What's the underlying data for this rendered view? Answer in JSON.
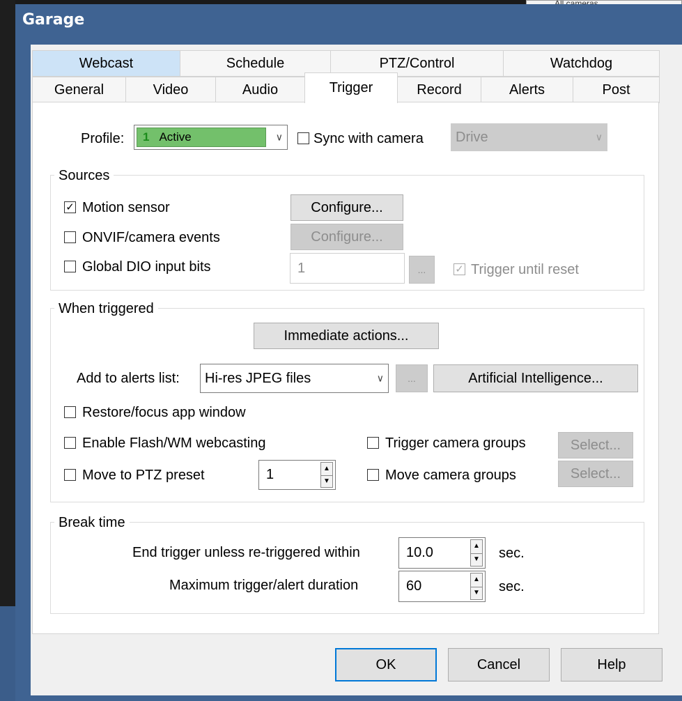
{
  "window": {
    "title": "Garage"
  },
  "background": {
    "camera_combo": "All cameras"
  },
  "tabs": {
    "row1": [
      "Webcast",
      "Schedule",
      "PTZ/Control",
      "Watchdog"
    ],
    "row2": [
      "General",
      "Video",
      "Audio",
      "Trigger",
      "Record",
      "Alerts",
      "Post"
    ],
    "active": "Trigger",
    "highlighted": "Webcast"
  },
  "profile": {
    "label": "Profile:",
    "selected_number": "1",
    "selected_name": "Active",
    "selected_color": "#73c06b",
    "sync_label": "Sync with camera",
    "sync_checked": false,
    "sync_value": "Drive"
  },
  "sources": {
    "title": "Sources",
    "motion_sensor": {
      "label": "Motion sensor",
      "checked": true,
      "button": "Configure..."
    },
    "onvif": {
      "label": "ONVIF/camera events",
      "checked": false,
      "button": "Configure..."
    },
    "dio": {
      "label": "Global DIO input bits",
      "checked": false,
      "value": "1",
      "browse": "...",
      "trigger_until_reset": "Trigger until reset",
      "trigger_until_reset_checked": true
    }
  },
  "when_triggered": {
    "title": "When triggered",
    "immediate_actions": "Immediate actions...",
    "add_to_alerts_label": "Add to alerts list:",
    "add_to_alerts_value": "Hi-res JPEG files",
    "alerts_browse": "...",
    "ai_button": "Artificial Intelligence...",
    "restore_focus": "Restore/focus app window",
    "enable_flash": "Enable Flash/WM webcasting",
    "move_ptz": "Move to PTZ preset",
    "ptz_value": "1",
    "trigger_groups": "Trigger camera groups",
    "move_groups": "Move camera groups",
    "select_label": "Select..."
  },
  "break_time": {
    "title": "Break time",
    "end_trigger_label": "End trigger unless re-triggered within",
    "end_trigger_value": "10.0",
    "max_duration_label": "Maximum trigger/alert duration",
    "max_duration_value": "60",
    "unit": "sec."
  },
  "buttons": {
    "ok": "OK",
    "cancel": "Cancel",
    "help": "Help"
  }
}
